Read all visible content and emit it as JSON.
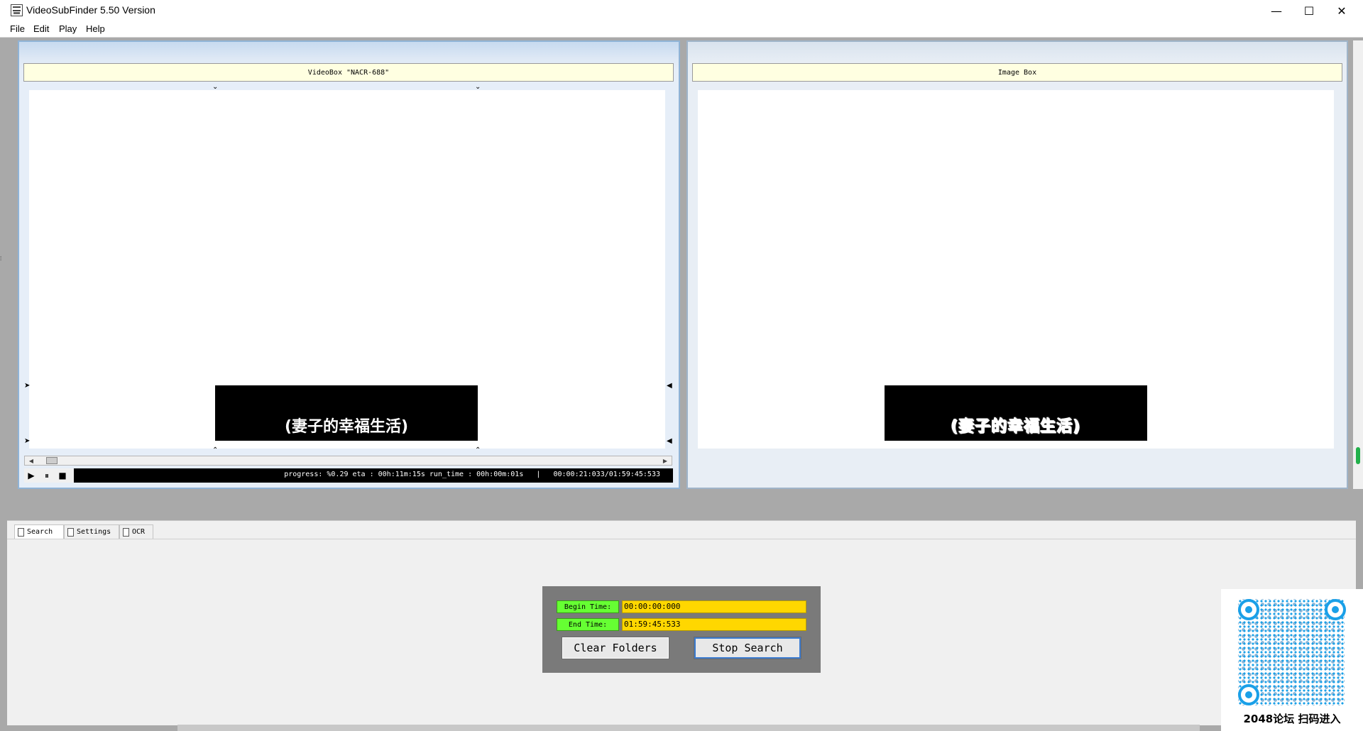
{
  "window": {
    "title": "VideoSubFinder 5.50 Version",
    "minimize_icon": "—",
    "maximize_icon": "☐",
    "close_icon": "✕"
  },
  "menu": [
    "File",
    "Edit",
    "Play",
    "Help"
  ],
  "video_box": {
    "header": "VideoBox \"NACR-688\"",
    "subtitle": "(妻子的幸福生活)"
  },
  "image_box": {
    "header": "Image Box",
    "subtitle": "(妻子的幸福生活)"
  },
  "player": {
    "play_icon": "▶",
    "pause_icon": "⏸",
    "stop_icon": "■",
    "status": "progress: %0.29 eta : 00h:11m:15s run_time : 00h:00m:01s   |   00:00:21:033/01:59:45:533"
  },
  "tabs": [
    "Search",
    "Settings",
    "OCR"
  ],
  "search": {
    "begin_label": "Begin Time:",
    "begin_value": "00:00:00:000",
    "end_label": "End Time:",
    "end_value": "01:59:45:533",
    "clear_button": "Clear Folders",
    "stop_button": "Stop Search"
  },
  "overlay": {
    "caption": "2048论坛 扫码进入"
  }
}
